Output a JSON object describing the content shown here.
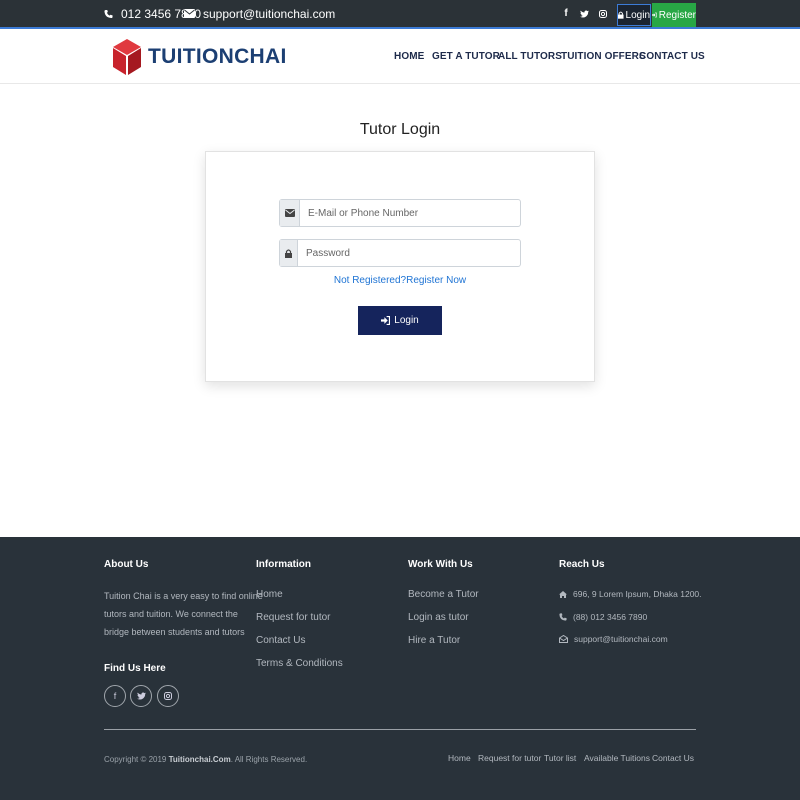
{
  "topbar": {
    "phone": "012 3456 7890",
    "email": "support@tuitionchai.com",
    "social": [
      "f",
      "t",
      "ig"
    ],
    "login_label": "Login",
    "register_label": "Register"
  },
  "brand": {
    "name": "TUITIONCHAI"
  },
  "nav": [
    "HOME",
    "GET A TUTOR",
    "ALL TUTORS",
    "TUITION OFFERS",
    "CONTACT US"
  ],
  "login": {
    "title": "Tutor Login",
    "email_placeholder": "E-Mail or Phone Number",
    "password_placeholder": "Password",
    "register_link": "Not Registered?Register Now",
    "button_label": "Login"
  },
  "footer": {
    "about": {
      "title": "About Us",
      "lines": [
        "Tuition Chai is a very easy to find online",
        "tutors and tuition. We connect the",
        "bridge between students and tutors"
      ]
    },
    "find_us": {
      "title": "Find Us Here"
    },
    "information": {
      "title": "Information",
      "links": [
        "Home",
        "Request for tutor",
        "Contact Us",
        "Terms & Conditions"
      ]
    },
    "work": {
      "title": "Work With Us",
      "links": [
        "Become a Tutor",
        "Login as tutor",
        "Hire a Tutor"
      ]
    },
    "reach": {
      "title": "Reach Us",
      "address": "696, 9 Lorem Ipsum, Dhaka 1200.",
      "phone": "(88) 012 3456 7890",
      "email": "support@tuitionchai.com"
    },
    "copyright_prefix": "Copyright © 2019",
    "copyright_brand": "Tuitionchai.Com",
    "copyright_suffix": ". All Rights Reserved.",
    "bottom_links": [
      "Home",
      "Request for tutor",
      "Tutor list",
      "Available Tuitions",
      "Contact Us"
    ]
  },
  "colors": {
    "topbar_bg": "#2b3237",
    "accent_blue": "#3c7bd6",
    "register_green": "#28a745",
    "brand_navy": "#1c3f73",
    "login_button": "#15245c",
    "link_blue": "#1f74d4",
    "footer_bg": "#29323a",
    "logo_red": "#c8232c"
  }
}
